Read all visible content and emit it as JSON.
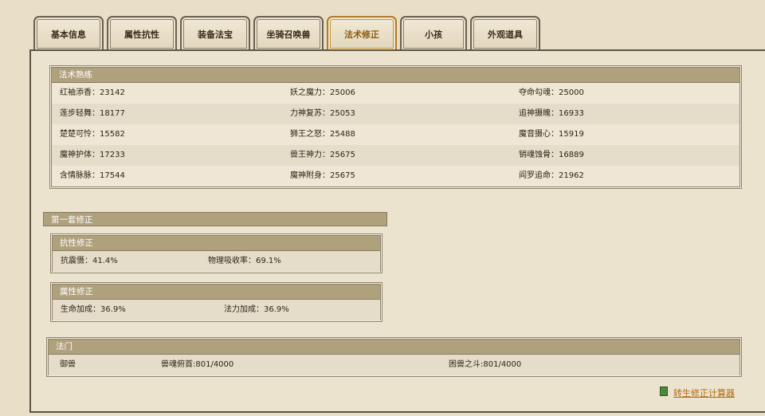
{
  "tabs": [
    "基本信息",
    "属性抗性",
    "装备法宝",
    "坐骑召唤兽",
    "法术修正",
    "小孩",
    "外观道具"
  ],
  "active_tab": "法术修正",
  "proficiency": {
    "title": "法术熟练",
    "rows": [
      [
        "红袖添香：23142",
        "妖之魔力：25006",
        "夺命勾魂：25000"
      ],
      [
        "莲步轻舞：18177",
        "力神复苏：25053",
        "追神摄魄：16933"
      ],
      [
        "楚楚可怜：15582",
        "狮王之怒：25488",
        "魔音摄心：15919"
      ],
      [
        "魔神护体：17233",
        "兽王神力：25675",
        "销魂蚀骨：16889"
      ],
      [
        "含情脉脉：17544",
        "魔神附身：25675",
        "阎罗追命：21962"
      ]
    ]
  },
  "set1": {
    "title": "第一套修正",
    "resist": {
      "title": "抗性修正",
      "items": [
        "抗震慑：41.4%",
        "物理吸收率：69.1%"
      ]
    },
    "attr": {
      "title": "属性修正",
      "items": [
        "生命加成：36.9%",
        "法力加成：36.9%"
      ]
    }
  },
  "school": {
    "title": "法门",
    "items": [
      "御兽",
      "兽魂俯首:801/4000",
      "困兽之斗:801/4000"
    ]
  },
  "calculator_link": "转生修正计算器",
  "colors": {
    "header": "#b0a17d",
    "link": "#b36a10",
    "active_tab": "#b07a25"
  }
}
